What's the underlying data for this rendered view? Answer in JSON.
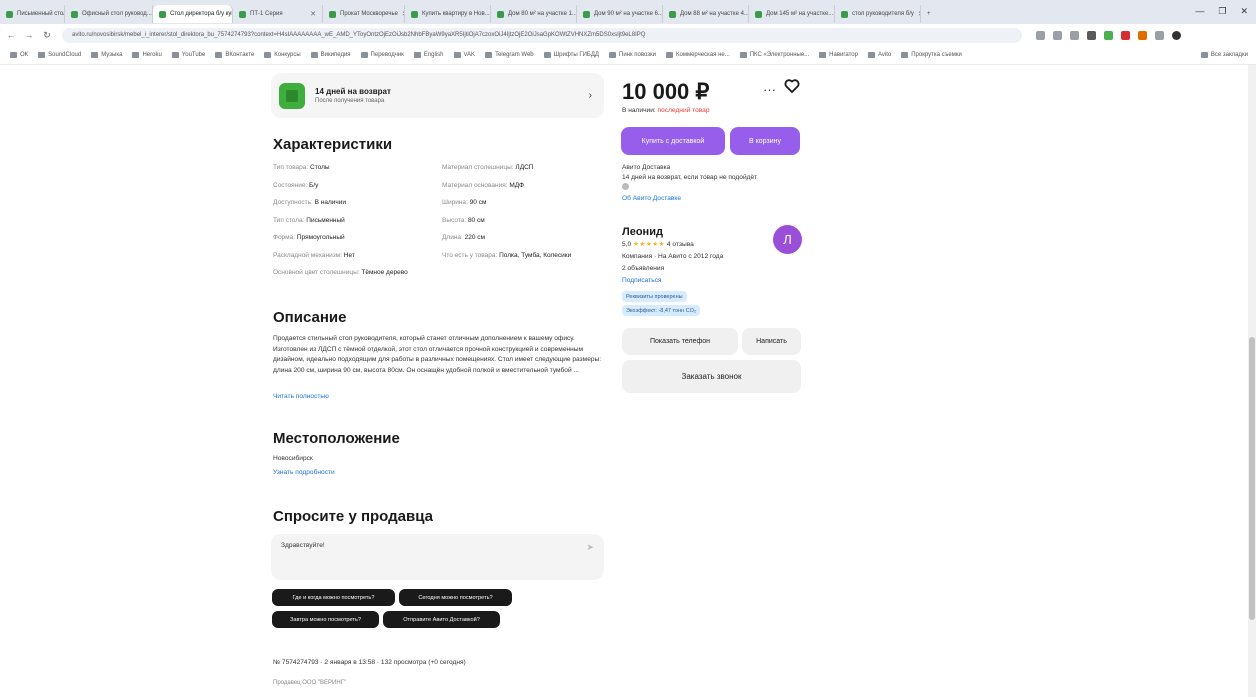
{
  "browser": {
    "tabs": [
      {
        "label": "Письменный стол руков...",
        "active": false
      },
      {
        "label": "Офисный стол руковод...",
        "active": false
      },
      {
        "label": "Стол директора б/у купит...",
        "active": true
      },
      {
        "label": "ПТ-1 Серия",
        "active": false
      },
      {
        "label": "Прокат Москворечье",
        "active": false
      },
      {
        "label": "Купить квартиру в Нов...",
        "active": false
      },
      {
        "label": "Дом 80 м² на участке 1...",
        "active": false
      },
      {
        "label": "Дом 90 м² на участке 6...",
        "active": false
      },
      {
        "label": "Дом 88 м² на участке 4...",
        "active": false
      },
      {
        "label": "Дом 145 м² на участке...",
        "active": false
      },
      {
        "label": "стол руководителя б/у",
        "active": false
      }
    ],
    "url": "avito.ru/novosibirsk/mebel_i_interer/stol_direktora_bu_7574274793?context=H4sIAAAAAAAA_wE_AMD_YToyOntzOjEzOiJsb2NhbFByaW9yaXR5IjtiOjA7czoxOiJ4IjtzOjE2OiJsaGpKOWtZVHNXZm5DS0xsIjt9eL8IPQ",
    "bookmarks": [
      "ОК",
      "SoundCloud",
      "Музыка",
      "Heroku",
      "YouTube",
      "ВКонтакте",
      "Конкурсы",
      "Википедия",
      "Переводчик",
      "English",
      "VAK",
      "Telegram Web",
      "Шрифты ГИБДД",
      "Пинк повозки",
      "Коммерческая не...",
      "ПКС «Электронные...",
      "Навигатор",
      "Avito",
      "Прокрутка съемки"
    ],
    "bookmarks_right": "Все закладки"
  },
  "return_card": {
    "title": "14 дней на возврат",
    "subtitle": "После получения товара"
  },
  "characteristics": {
    "title": "Характеристики",
    "left": [
      {
        "k": "Тип товара: ",
        "v": "Столы"
      },
      {
        "k": "Состояние: ",
        "v": "Б/у"
      },
      {
        "k": "Доступность: ",
        "v": "В наличии"
      },
      {
        "k": "Тип стола: ",
        "v": "Письменный"
      },
      {
        "k": "Форма: ",
        "v": "Прямоугольный"
      },
      {
        "k": "Раскладной механизм: ",
        "v": "Нет"
      },
      {
        "k": "Основной цвет столешницы: ",
        "v": "Тёмное дерево"
      }
    ],
    "right": [
      {
        "k": "Материал столешницы: ",
        "v": "ЛДСП"
      },
      {
        "k": "Материал основания: ",
        "v": "МДФ"
      },
      {
        "k": "Ширина: ",
        "v": "90 см"
      },
      {
        "k": "Высота: ",
        "v": "80 см"
      },
      {
        "k": "Длина: ",
        "v": "220 см"
      },
      {
        "k": "Что есть у товара: ",
        "v": "Полка, Тумба, Колесики"
      }
    ]
  },
  "description": {
    "title": "Описание",
    "text": "Продается стильный стол руководителя, который станет отличным дополнением к вашему офису. Изготовлен из ЛДСП с тёмной отделкой, этот стол отличается прочной конструкцией и современным дизайном, идеально подходящим для работы в различных помещениях. Стол имеет следующие размеры: длина 200 см, ширина 90 см, высота 80см. Он оснащён удобной полкой и вместительной тумбой ...",
    "read_more": "Читать полностью"
  },
  "location": {
    "title": "Местоположение",
    "city": "Новосибирск",
    "details_link": "Узнать подробности"
  },
  "ask": {
    "title": "Спросите у продавца",
    "input_value": "Здравствуйте!",
    "chips": [
      "Где и когда можно посмотреть?",
      "Сегодня можно посмотреть?",
      "Завтра можно посмотреть?",
      "Отправите Авито Доставкой?"
    ]
  },
  "ad_info": "№ 7574274793 · 2 января в 13:58 · 132 просмотра (+0 сегодня)",
  "seller_footer": "Продавец ООО \"ВЕРИНГ\"",
  "sidebar": {
    "price": "10 000 ₽",
    "stock_prefix": "В наличии: ",
    "stock_value": "последний товар",
    "buy_delivery": "Купить с доставкой",
    "add_cart": "В корзину",
    "delivery_title": "Авито Доставка",
    "delivery_text": "14 дней на возврат, если товар не подойдёт",
    "delivery_link": "Об Авито Доставке",
    "seller_name": "Леонид",
    "rating": "5,0",
    "stars": "★★★★★",
    "reviews": "4 отзыва",
    "company": "Компания · На Авито с 2012 года",
    "ads_count": "2 объявления",
    "subscribe": "Подписаться",
    "avatar_letter": "Л",
    "badge1": "Реквизиты проверены",
    "badge2": "Экоэффект: -8,47 тонн CO₂",
    "show_phone": "Показать телефон",
    "write": "Написать",
    "order_call": "Заказать звонок"
  },
  "colors": {
    "accent": "#965eeb",
    "link": "#1a73d9",
    "red": "#f23a3a",
    "avatar": "#9b4fd9",
    "star": "#ffb21e"
  }
}
